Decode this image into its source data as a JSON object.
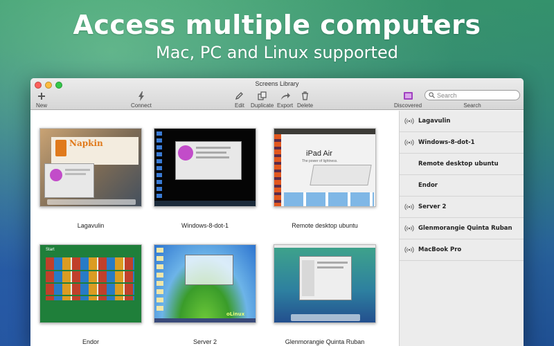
{
  "headline": "Access multiple computers",
  "subline": "Mac, PC and Linux supported",
  "window": {
    "title": "Screens Library"
  },
  "toolbar": {
    "new": "New",
    "connect": "Connect",
    "edit": "Edit",
    "duplicate": "Duplicate",
    "export": "Export",
    "delete": "Delete",
    "discovered": "Discovered",
    "search_placeholder": "Search",
    "search_label": "Search"
  },
  "screens": [
    {
      "name": "Lagavulin"
    },
    {
      "name": "Windows-8-dot-1"
    },
    {
      "name": "Remote desktop ubuntu"
    },
    {
      "name": "Endor"
    },
    {
      "name": "Server 2"
    },
    {
      "name": "Glenmorangie Quinta Ruban"
    }
  ],
  "thumb_text": {
    "napkin": "Napkin",
    "ipad_air": "iPad Air",
    "ipad_tagline": "The power of lightness.",
    "start": "Start",
    "olinux": "oLinux"
  },
  "sidebar": {
    "items": [
      {
        "label": "Lagavulin",
        "icon": "broadcast-icon"
      },
      {
        "label": "Windows-8-dot-1",
        "icon": "broadcast-icon"
      },
      {
        "label": "Remote desktop ubuntu",
        "icon": "none"
      },
      {
        "label": "Endor",
        "icon": "none"
      },
      {
        "label": "Server 2",
        "icon": "broadcast-icon"
      },
      {
        "label": "Glenmorangie Quinta Ruban",
        "icon": "broadcast-icon"
      },
      {
        "label": "MacBook Pro",
        "icon": "broadcast-icon"
      }
    ]
  },
  "colors": {
    "discovered_accent": "#a040c0",
    "traffic_red": "#fc605c",
    "traffic_yellow": "#fdbc40",
    "traffic_green": "#34c84a"
  }
}
